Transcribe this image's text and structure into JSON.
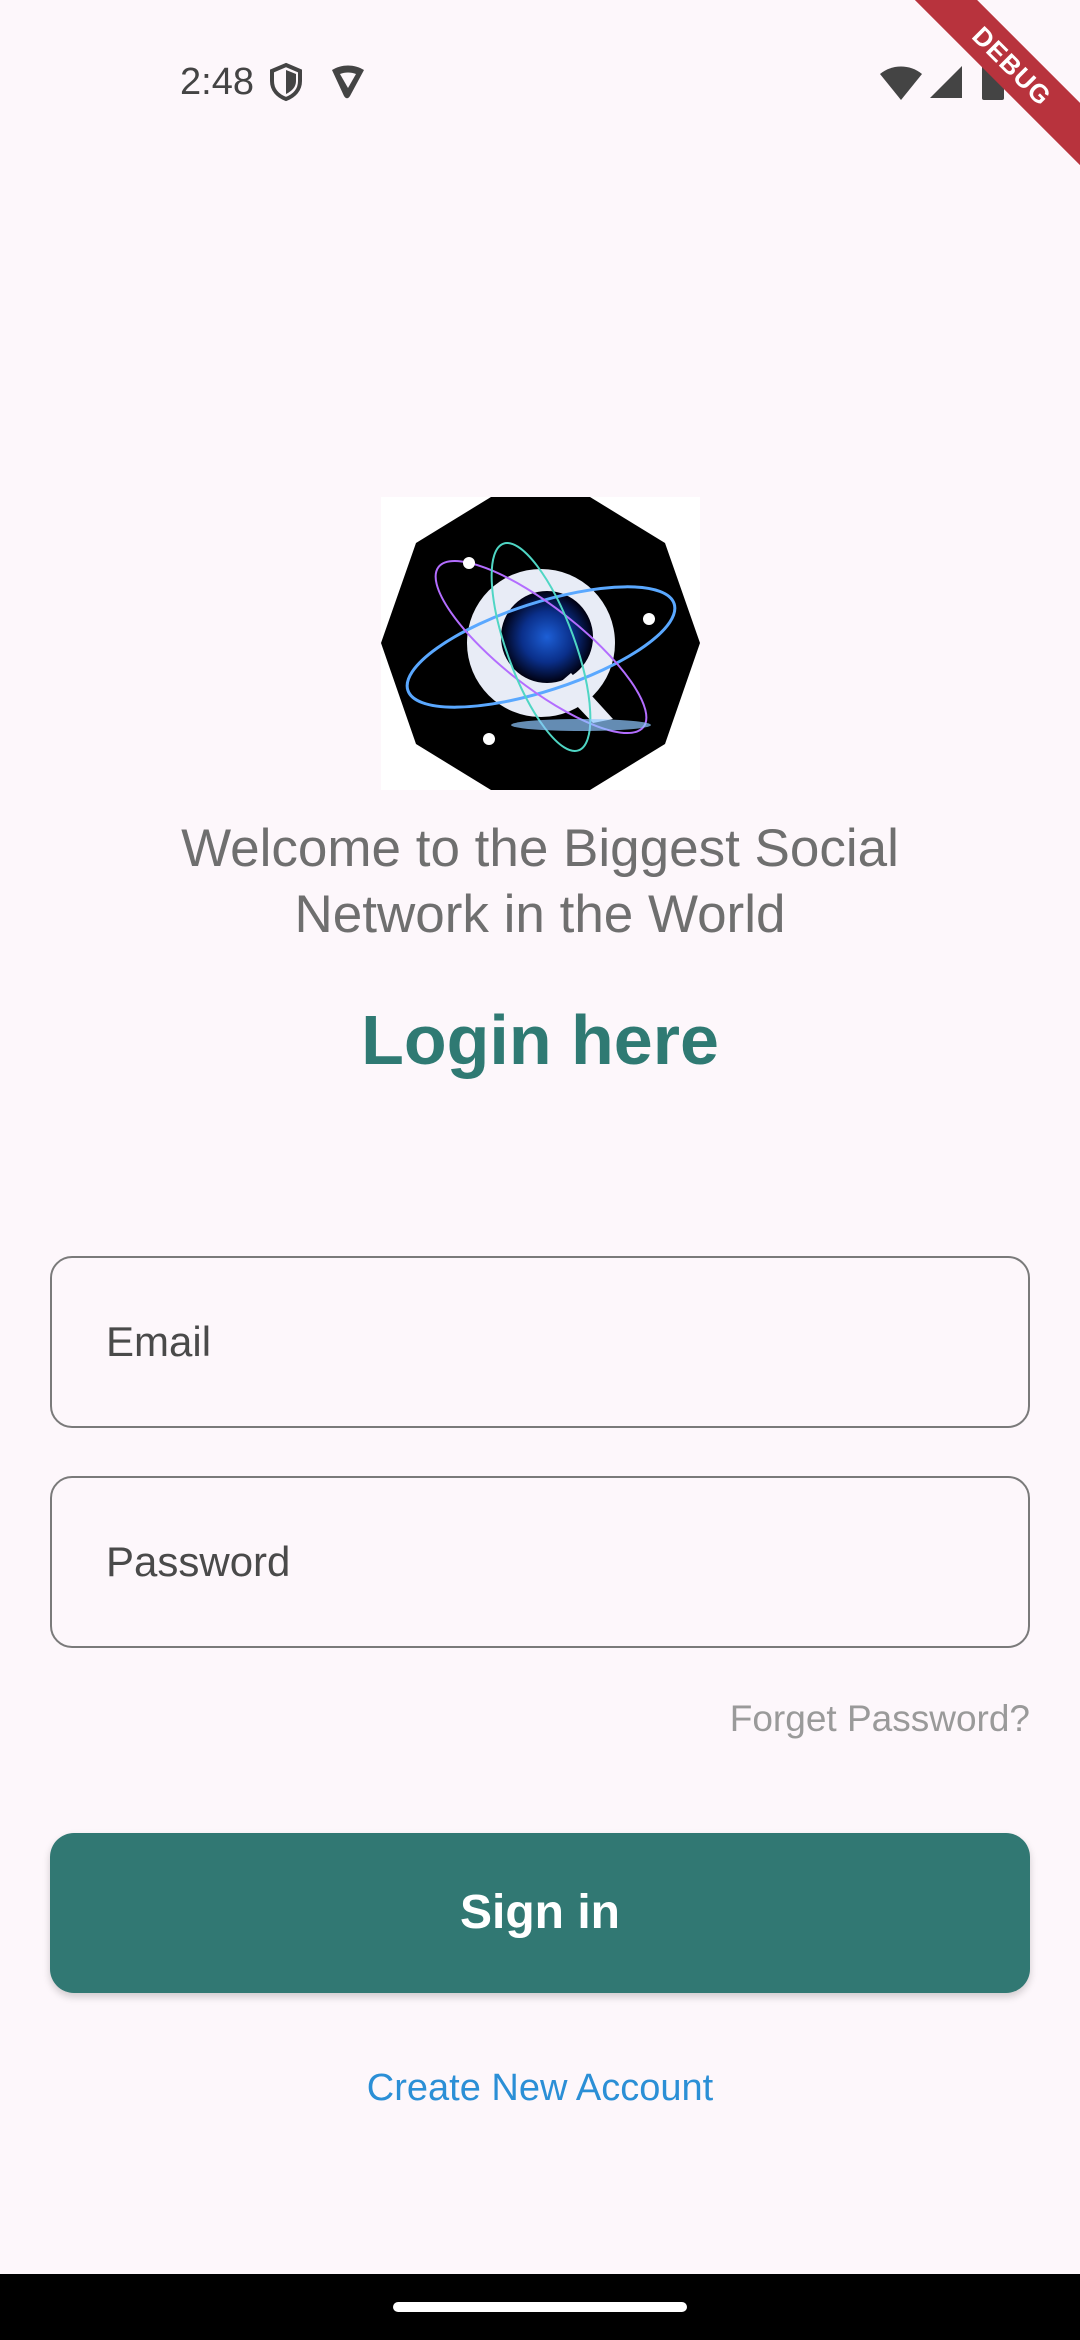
{
  "status_bar": {
    "time": "2:48",
    "icons": [
      "shield-icon",
      "vpn-icon",
      "wifi-icon",
      "signal-icon",
      "battery-icon"
    ]
  },
  "debug_banner": "DEBUG",
  "logo": {
    "icon": "app-logo-q-atom"
  },
  "welcome_text": "Welcome to the Biggest Social Network in the World",
  "login_title": "Login here",
  "form": {
    "email_label": "Email",
    "password_label": "Password",
    "forget_password": "Forget Password?",
    "signin_label": "Sign in",
    "create_account": "Create New Account"
  },
  "colors": {
    "primary": "#317873",
    "title": "#2f7a73",
    "link": "#2b8fd6",
    "background": "#fdf7fb"
  }
}
